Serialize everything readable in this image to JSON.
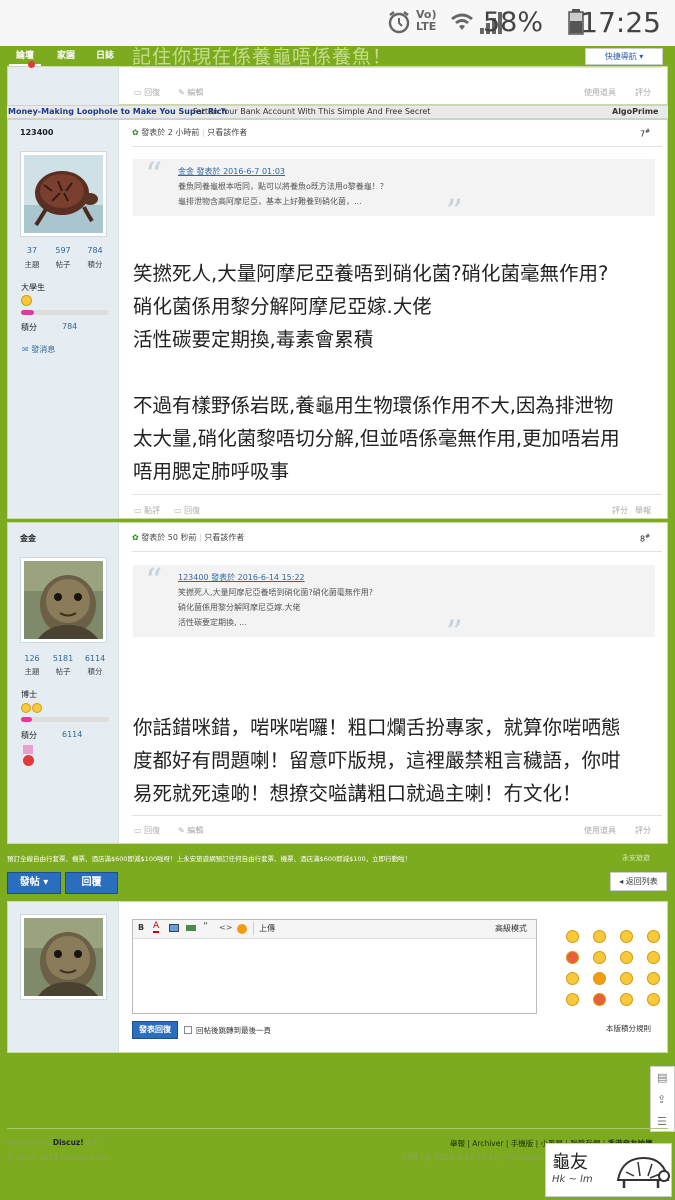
{
  "status": {
    "time": "17:25",
    "battery": "58%",
    "network": "LTE"
  },
  "nav": {
    "items": [
      "論壇",
      "家園",
      "日誌"
    ],
    "quick_nav": "快捷導航"
  },
  "thread_title": "記住你現在係養龜唔係養魚！",
  "prev_post_actions": {
    "reply": "回復",
    "edit": "編輯",
    "tools": "使用道具",
    "rate": "評分"
  },
  "ad": {
    "left": "Money-Making Loophole to Make You Super Rich",
    "middle": "Fatten Your Bank Account With This Simple And Free Secret",
    "right": "AlgoPrime"
  },
  "posts": [
    {
      "author": "123400",
      "stats": [
        {
          "value": "37",
          "label": "主題"
        },
        {
          "value": "597",
          "label": "帖子"
        },
        {
          "value": "784",
          "label": "積分"
        }
      ],
      "rank": "大學生",
      "score_label": "積分",
      "score": "784",
      "score_level": 0.15,
      "message_link": "發消息",
      "posted": "發表於 2 小時前",
      "only_author": "只看該作者",
      "floor": "7",
      "quote": {
        "header": "金金 發表於 2016-6-7 01:03",
        "lines": [
          "養魚同養龜根本唔同，點可以將養魚o既方法用o黎養龜！？",
          "龜排泄物含高阿摩尼亞，基本上好難養到硝化菌，..."
        ]
      },
      "body": [
        "笑撚死人,大量阿摩尼亞養唔到硝化菌?硝化菌毫無作用?",
        "硝化菌係用黎分解阿摩尼亞嫁.大佬",
        "活性碳要定期換,毒素會累積",
        "",
        "不過有樣野係岩既,養龜用生物環係作用不大,因為排泄物",
        "太大量,硝化菌黎唔切分解,但並唔係毫無作用,更加唔岩用",
        "唔用腮定肺呼吸事"
      ],
      "actions": {
        "left1": "點評",
        "left2": "回復",
        "right1": "評分",
        "right2": "舉報"
      }
    },
    {
      "author": "金金",
      "stats": [
        {
          "value": "126",
          "label": "主題"
        },
        {
          "value": "5181",
          "label": "帖子"
        },
        {
          "value": "6114",
          "label": "積分"
        }
      ],
      "rank": "博士",
      "score_label": "積分",
      "score": "6114",
      "score_level": 0.12,
      "posted": "發表於 50 秒前",
      "only_author": "只看該作者",
      "floor": "8",
      "quote": {
        "header": "123400 發表於 2016-6-14 15:22",
        "lines": [
          "笑撚死人,大量阿摩尼亞養唔到硝化菌?硝化菌毫無作用?",
          "硝化菌係用黎分解阿摩尼亞嫁.大佬",
          "活性碳要定期換, ..."
        ]
      },
      "body": [
        "你話錯咪錯，啱咪啱囉！粗口爛舌扮專家，就算你啱哂態",
        "度都好有問題喇！留意吓版規，這裡嚴禁粗言穢語，你咁",
        "易死就死遠啲！想撩交嗌講粗口就過主喇！冇文化！"
      ],
      "actions": {
        "reply": "回復",
        "edit": "編輯",
        "tools": "使用道具",
        "rate": "評分"
      }
    }
  ],
  "promo": {
    "text": "預訂全線自由行套票、機票、酒店滿$600即減$100啦呀！上永安旅遊網預訂任何自由行套票、機票、酒店滿$600即減$100，立即行動啦！",
    "right": "永安旅遊"
  },
  "buttons": {
    "post": "發帖",
    "reply": "回覆",
    "back": "返回列表"
  },
  "editor": {
    "tools": [
      "B",
      "A",
      "",
      "",
      "“",
      "<>",
      ""
    ],
    "upload": "上傳",
    "advanced": "高級模式",
    "submit": "發表回復",
    "checkbox_label": "回帖後跳轉到最後一頁",
    "rules": "本版積分規則"
  },
  "footer": {
    "powered": "Powered by",
    "brand": "Discuz!",
    "version": "X3.2",
    "copyright": "© 2001-2013 Comsenz Inc.",
    "links": [
      "舉報",
      "Archiver",
      "手機版",
      "小黑屋",
      "聯繫我們",
      "香港龜友論壇"
    ],
    "gmt": "GMT+8, 2016-6-14 17:24 , Processed in"
  },
  "side_tools": [
    "回帖",
    "返回頂部",
    "列表"
  ],
  "logo_text": "龜友"
}
